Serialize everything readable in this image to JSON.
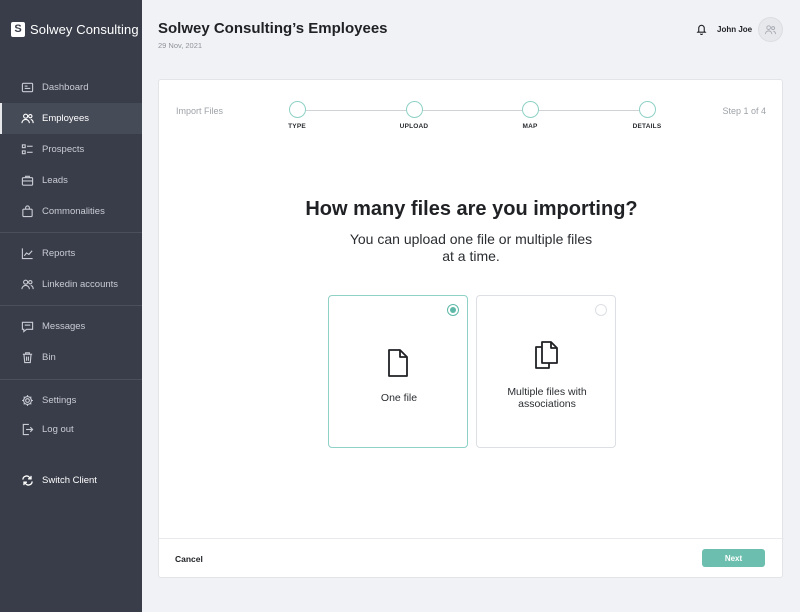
{
  "sidebar": {
    "brand": "Solwey Consulting",
    "logo_letter": "S",
    "items": [
      {
        "label": "Dashboard",
        "icon": "dashboard-icon"
      },
      {
        "label": "Employees",
        "icon": "users-icon",
        "active": true
      },
      {
        "label": "Prospects",
        "icon": "checklist-icon"
      },
      {
        "label": "Leads",
        "icon": "briefcase-icon"
      },
      {
        "label": "Commonalities",
        "icon": "bag-icon"
      },
      {
        "label": "Reports",
        "icon": "chart-icon"
      },
      {
        "label": "Linkedin accounts",
        "icon": "users-icon"
      },
      {
        "label": "Messages",
        "icon": "chat-icon"
      },
      {
        "label": "Bin",
        "icon": "trash-icon"
      },
      {
        "label": "Settings",
        "icon": "gear-icon"
      },
      {
        "label": "Log out",
        "icon": "logout-icon"
      }
    ],
    "switch_client": "Switch Client"
  },
  "header": {
    "title": "Solwey Consulting’s Employees",
    "date": "29 Nov, 2021",
    "user_name": "John Joe"
  },
  "wizard": {
    "label": "Import Files",
    "step_count": "Step 1 of 4",
    "steps": [
      "TYPE",
      "UPLOAD",
      "MAP",
      "DETAILS"
    ],
    "question": "How many files are you importing?",
    "subtext": "You can upload one file or multiple files at a time.",
    "options": [
      {
        "label": "One file",
        "icon": "file-icon",
        "selected": true
      },
      {
        "label": "Multiple files with associations",
        "icon": "files-icon",
        "selected": false
      }
    ],
    "cancel_label": "Cancel",
    "next_label": "Next"
  },
  "colors": {
    "sidebar_bg": "#393d49",
    "accent": "#6cbfae",
    "accent_border": "#8fd1c6"
  }
}
